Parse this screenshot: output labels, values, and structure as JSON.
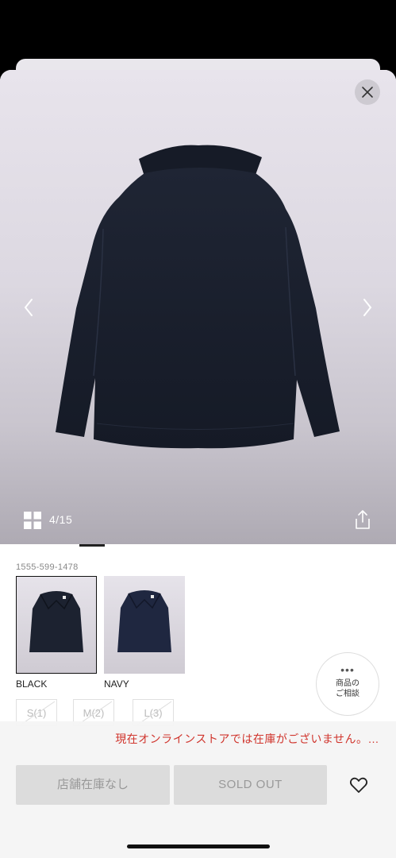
{
  "gallery": {
    "counter": "4/15",
    "image_icon": "jacket-back-photo"
  },
  "product": {
    "code": "1555-599-1478",
    "colors": [
      {
        "label": "BLACK",
        "selected": true
      },
      {
        "label": "NAVY",
        "selected": false
      }
    ],
    "sizes": [
      "S(1)",
      "M(2)",
      "L(3)"
    ],
    "consult_label_line1": "商品の",
    "consult_label_line2": "ご相談",
    "consult_dots": "•••"
  },
  "bottom": {
    "notice": "現在オンラインストアでは在庫がございません。…",
    "store_button": "店舗在庫なし",
    "sold_out_button": "SOLD OUT"
  },
  "colors": {
    "notice_red": "#d0342c",
    "garment": "#1c2230",
    "disabled_button": "#dcdcdc"
  }
}
